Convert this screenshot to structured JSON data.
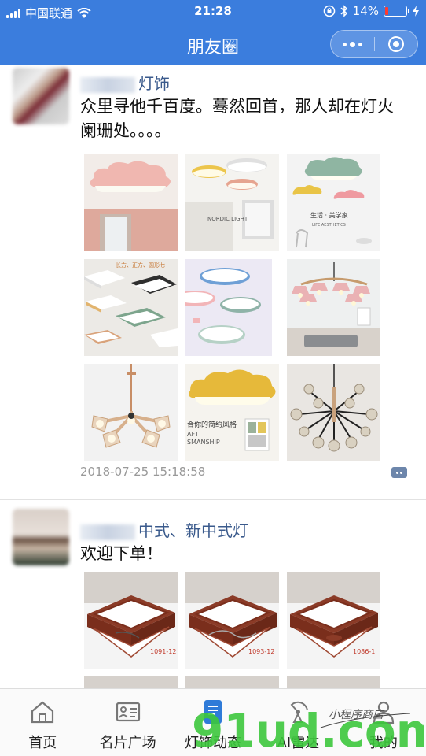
{
  "status_bar": {
    "carrier": "中国联通",
    "time": "21:28",
    "battery": "14%",
    "battery_level": 0.14
  },
  "navbar": {
    "title": "朋友圈"
  },
  "posts": [
    {
      "nickname_visible": "灯饰",
      "content": "众里寻他千百度。蓦然回首，那人却在灯火阑珊处。。。。",
      "timestamp": "2018-07-25 15:18:58",
      "image_text": {
        "img2": "NORDIC LIGHT",
        "img3a": "生活 · 美学家",
        "img3b": "LIFE AESTHETICS",
        "img4": "长方、正方、圆形七",
        "img8a": "合你的简约风格",
        "img8b": "AFT",
        "img8c": "SMANSHIP"
      }
    },
    {
      "nickname_visible": "中式、新中式灯",
      "content": "欢迎下单！",
      "image_codes": [
        "1091-12",
        "1093-12",
        "1086-1"
      ]
    }
  ],
  "tabbar": {
    "items": [
      {
        "label": "首页",
        "icon": "home-icon"
      },
      {
        "label": "名片广场",
        "icon": "card-icon"
      },
      {
        "label": "灯饰动态",
        "icon": "moments-icon"
      },
      {
        "label": "AI雷达",
        "icon": "radar-icon"
      },
      {
        "label": "我的",
        "icon": "user-icon"
      }
    ]
  },
  "watermark": {
    "brand": "91ud.com",
    "tagline": "小程序商店"
  },
  "colors": {
    "theme": "#3b7ddd",
    "nickname": "#3a5a8c",
    "accent_tab": "#2f7bd8"
  }
}
